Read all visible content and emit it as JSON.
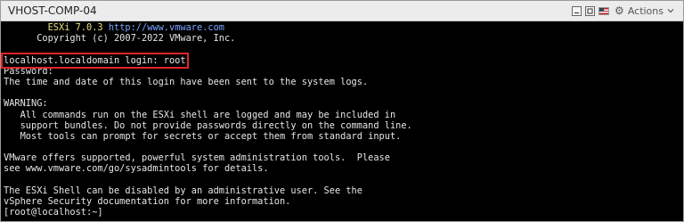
{
  "window": {
    "title": "VHOST-COMP-04",
    "actions_label": "Actions",
    "icons": [
      "minimize-window-icon",
      "restore-window-icon",
      "keyboard-language-flag-icon",
      "settings-gear-icon",
      "chevron-down-icon"
    ]
  },
  "terminal": {
    "header": {
      "product_indent": "        ",
      "product": "ESXi 7.0.3",
      "url": "http://www.vmware.com",
      "copyright": "      Copyright (c) 2007-2022 VMware, Inc."
    },
    "login_line": "localhost.localdomain login: root",
    "lines": [
      "Password:",
      "The time and date of this login have been sent to the system logs.",
      "",
      "WARNING:",
      "   All commands run on the ESXi shell are logged and may be included in",
      "   support bundles. Do not provide passwords directly on the command line.",
      "   Most tools can prompt for secrets or accept them from standard input.",
      "",
      "VMware offers supported, powerful system administration tools.  Please",
      "see www.vmware.com/go/sysadmintools for details.",
      "",
      "The ESXi Shell can be disabled by an administrative user. See the",
      "vSphere Security documentation for more information.",
      "[root@localhost:~]"
    ],
    "colors": {
      "text": "#e6e6e6",
      "product": "#e8e07a",
      "url": "#7aa4ff",
      "highlight": "#e2242a"
    }
  }
}
